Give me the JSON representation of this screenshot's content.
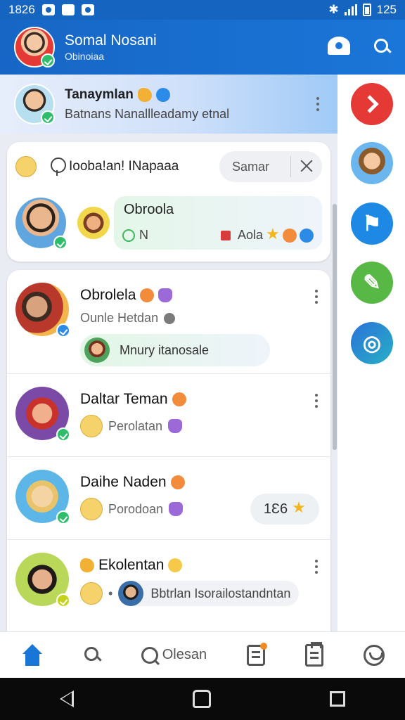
{
  "status_bar": {
    "time": "1826",
    "battery": "125"
  },
  "app_bar": {
    "title": "Somal Nosani",
    "subtitle": "Obinoiaa"
  },
  "pinned": {
    "title": "Tanaymlan",
    "subtitle": "Batnans Nanallleadamy etnal"
  },
  "card1": {
    "label": "Iooba!an! INapaaa",
    "search": {
      "value": "Samar"
    },
    "item": {
      "title": "Obroola",
      "left_text": "N",
      "right_text": "Aola"
    }
  },
  "chats": [
    {
      "name": "Obrolela",
      "preview": "Ounle Hetdan",
      "reply": "Mnury itanosale"
    },
    {
      "name": "Daltar Teman",
      "preview": "Perolatan"
    },
    {
      "name": "Daihe Naden",
      "preview": "Porodoan",
      "count": "1Ɛ6"
    },
    {
      "name": "Ekolentan",
      "preview": "Bbtrlan Isorailostandntan",
      "separator": "•"
    }
  ],
  "bottom_nav": {
    "search_label": "Olesan"
  },
  "colors": {
    "primary": "#1766c5",
    "accent_red": "#e53935",
    "accent_green": "#58b845",
    "online": "#2ebd6b"
  },
  "icons": [
    "home-icon",
    "search-icon",
    "message-icon",
    "clipboard-icon",
    "swirl-icon",
    "close-icon",
    "chevron-right-icon"
  ]
}
